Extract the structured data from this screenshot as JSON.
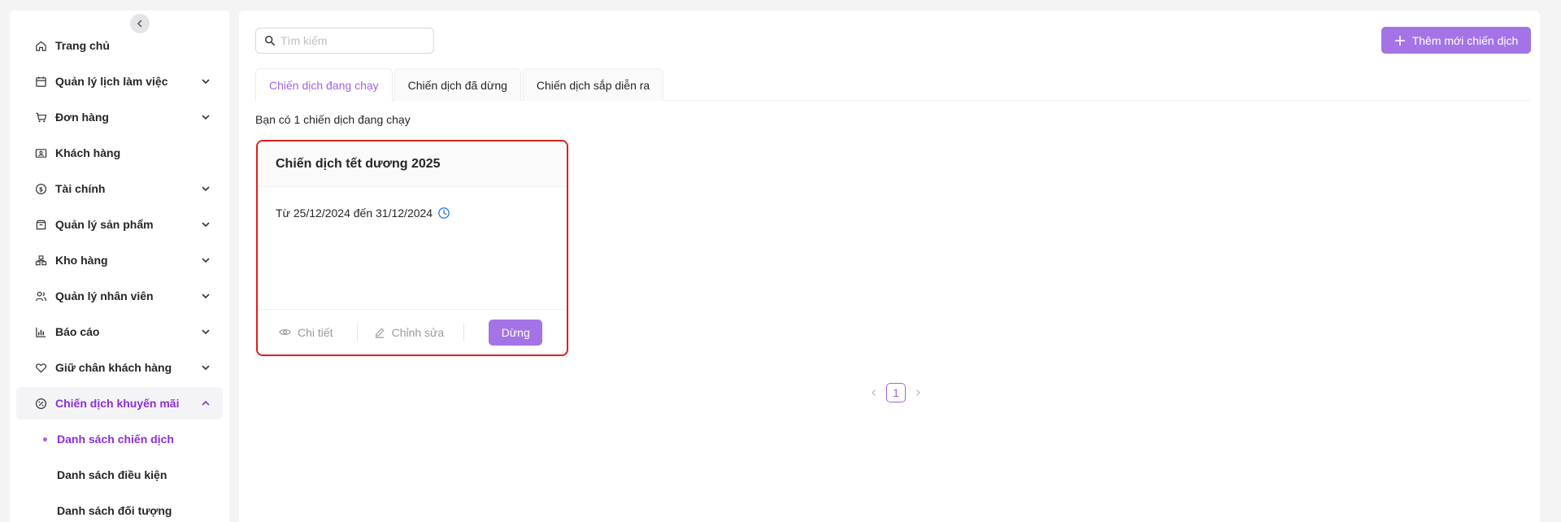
{
  "sidebar": {
    "items": [
      {
        "label": "Trang chủ",
        "icon": "home-icon",
        "expandable": false
      },
      {
        "label": "Quản lý lịch làm việc",
        "icon": "calendar-icon",
        "expandable": true
      },
      {
        "label": "Đơn hàng",
        "icon": "cart-icon",
        "expandable": true
      },
      {
        "label": "Khách hàng",
        "icon": "id-card-icon",
        "expandable": false
      },
      {
        "label": "Tài chính",
        "icon": "dollar-circle-icon",
        "expandable": true
      },
      {
        "label": "Quản lý sản phẩm",
        "icon": "box-icon",
        "expandable": true
      },
      {
        "label": "Kho hàng",
        "icon": "warehouse-icon",
        "expandable": true
      },
      {
        "label": "Quản lý nhân viên",
        "icon": "users-icon",
        "expandable": true
      },
      {
        "label": "Báo cáo",
        "icon": "bar-chart-icon",
        "expandable": true
      },
      {
        "label": "Giữ chân khách hàng",
        "icon": "heart-icon",
        "expandable": true
      },
      {
        "label": "Chiến dịch khuyến mãi",
        "icon": "discount-icon",
        "expandable": true,
        "active": true
      }
    ],
    "subitems": [
      {
        "label": "Danh sách chiến dịch",
        "active": true
      },
      {
        "label": "Danh sách điều kiện"
      },
      {
        "label": "Danh sách đối tượng"
      }
    ]
  },
  "search": {
    "placeholder": "Tìm kiếm"
  },
  "toolbar": {
    "add_label": "Thêm mới chiến dịch"
  },
  "tabs": [
    {
      "label": "Chiến dịch đang chạy",
      "active": true
    },
    {
      "label": "Chiến dịch đã dừng"
    },
    {
      "label": "Chiến dịch sắp diễn ra"
    }
  ],
  "summary": "Bạn có 1 chiến dịch đang chạy",
  "campaign": {
    "title": "Chiến dịch tết dương 2025",
    "date_range": "Từ 25/12/2024 đến 31/12/2024",
    "detail_label": "Chi tiết",
    "edit_label": "Chỉnh sửa",
    "stop_label": "Dừng"
  },
  "pagination": {
    "current": "1"
  },
  "colors": {
    "accent": "#a474e6",
    "active_text": "#8b2fd4",
    "highlight_border": "#e01e1e"
  }
}
